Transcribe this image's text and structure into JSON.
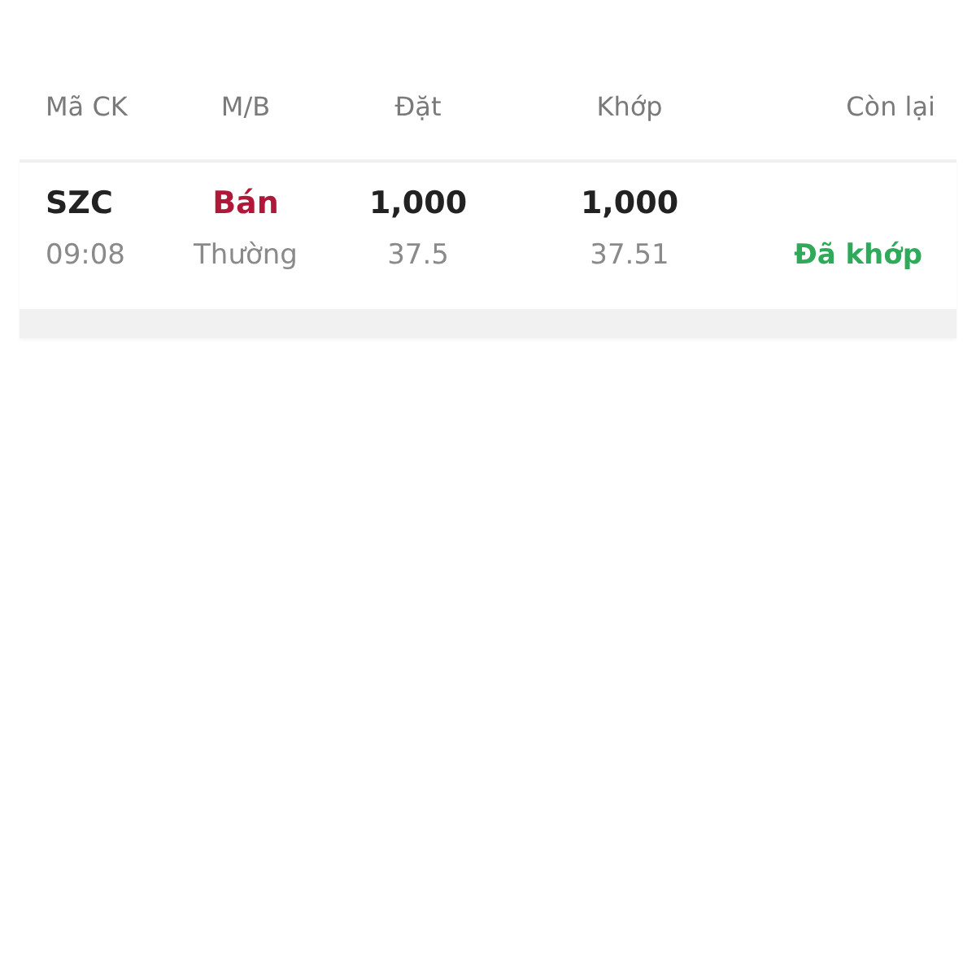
{
  "columns": [
    "Mã CK",
    "M/B",
    "Đặt",
    "Khớp",
    "Còn lại"
  ],
  "orders": [
    {
      "symbol": "SZC",
      "time": "09:08",
      "side": {
        "text": "Bán",
        "kind": "sell"
      },
      "order_type": "Thường",
      "order_qty": "1,000",
      "order_price": "37.5",
      "matched_qty": "1,000",
      "matched_price": "37.51",
      "status": {
        "text": "Đã khớp",
        "kind": "filled"
      }
    }
  ]
}
